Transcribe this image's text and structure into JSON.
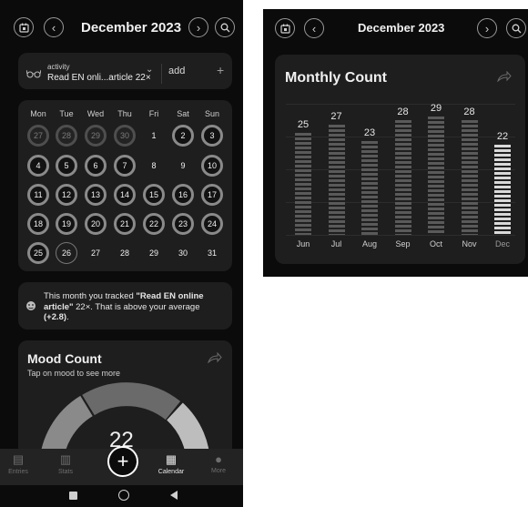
{
  "left": {
    "header": {
      "title": "December 2023"
    },
    "activity": {
      "label": "activity",
      "value": "Read EN onli...article 22×",
      "add_label": "add",
      "plus": "+"
    },
    "calendar": {
      "weekdays": [
        "Mon",
        "Tue",
        "Wed",
        "Thu",
        "Fri",
        "Sat",
        "Sun"
      ],
      "weeks": [
        [
          {
            "d": "27",
            "s": "dim"
          },
          {
            "d": "28",
            "s": "dim"
          },
          {
            "d": "29",
            "s": "dim"
          },
          {
            "d": "30",
            "s": "dim"
          },
          {
            "d": "1",
            "s": "plain"
          },
          {
            "d": "2",
            "s": "ring"
          },
          {
            "d": "3",
            "s": "ring"
          }
        ],
        [
          {
            "d": "4",
            "s": "ring"
          },
          {
            "d": "5",
            "s": "ring"
          },
          {
            "d": "6",
            "s": "ring"
          },
          {
            "d": "7",
            "s": "ring"
          },
          {
            "d": "8",
            "s": "plain"
          },
          {
            "d": "9",
            "s": "plain"
          },
          {
            "d": "10",
            "s": "ring"
          }
        ],
        [
          {
            "d": "11",
            "s": "ring"
          },
          {
            "d": "12",
            "s": "ring"
          },
          {
            "d": "13",
            "s": "ring"
          },
          {
            "d": "14",
            "s": "ring"
          },
          {
            "d": "15",
            "s": "ring"
          },
          {
            "d": "16",
            "s": "ring"
          },
          {
            "d": "17",
            "s": "ring"
          }
        ],
        [
          {
            "d": "18",
            "s": "ring"
          },
          {
            "d": "19",
            "s": "ring"
          },
          {
            "d": "20",
            "s": "ring"
          },
          {
            "d": "21",
            "s": "ring"
          },
          {
            "d": "22",
            "s": "ring"
          },
          {
            "d": "23",
            "s": "ring"
          },
          {
            "d": "24",
            "s": "ring"
          }
        ],
        [
          {
            "d": "25",
            "s": "ring"
          },
          {
            "d": "26",
            "s": "thin"
          },
          {
            "d": "27",
            "s": "plain"
          },
          {
            "d": "28",
            "s": "plain"
          },
          {
            "d": "29",
            "s": "plain"
          },
          {
            "d": "30",
            "s": "plain"
          },
          {
            "d": "31",
            "s": "plain"
          }
        ]
      ]
    },
    "insight": {
      "pre": "This month you tracked ",
      "bold1": "\"Read EN online article\"",
      "mid": " 22×. That is above your average ",
      "bold2": "(+2.8)",
      "post": "."
    },
    "mood": {
      "title": "Mood Count",
      "subtitle": "Tap on mood to see more",
      "count": "22"
    },
    "nav": [
      {
        "label": "Entries",
        "icon": "entries-icon"
      },
      {
        "label": "Stats",
        "icon": "stats-icon"
      },
      {
        "label": "",
        "icon": "add-icon"
      },
      {
        "label": "Calendar",
        "icon": "calendar-icon"
      },
      {
        "label": "More",
        "icon": "more-icon"
      }
    ]
  },
  "right": {
    "header": {
      "title": "December 2023"
    },
    "monthly": {
      "title": "Monthly Count"
    }
  },
  "chart_data": {
    "type": "bar",
    "title": "Monthly Count",
    "categories": [
      "Jun",
      "Jul",
      "Aug",
      "Sep",
      "Oct",
      "Nov",
      "Dec"
    ],
    "values": [
      25,
      27,
      23,
      28,
      29,
      28,
      22
    ],
    "ylim": [
      0,
      32
    ],
    "highlight": "Dec"
  }
}
